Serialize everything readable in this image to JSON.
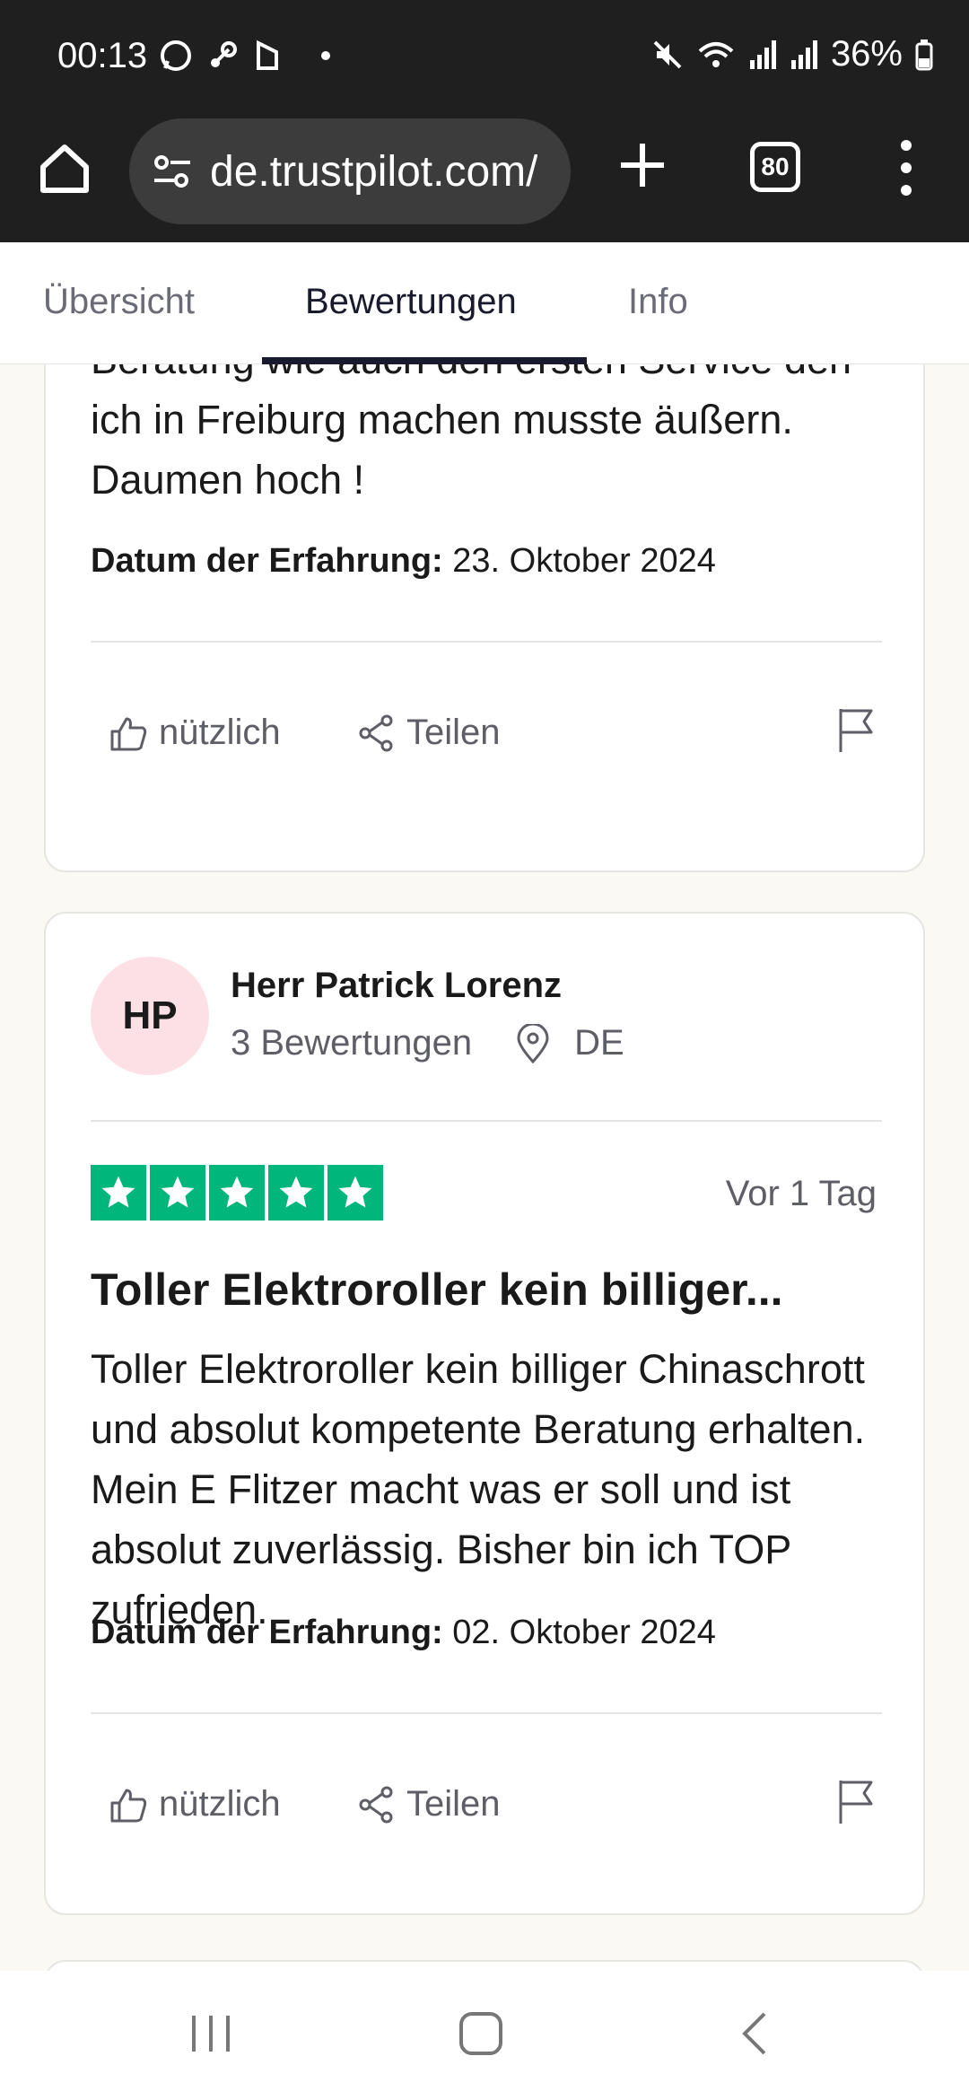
{
  "status_bar": {
    "time": "00:13",
    "battery": "36%"
  },
  "browser": {
    "url": "de.trustpilot.com/",
    "tab_count": "80"
  },
  "tabs": [
    {
      "label": "Übersicht"
    },
    {
      "label": "Bewertungen"
    },
    {
      "label": "Info"
    }
  ],
  "review1": {
    "body": "einfach nur positiv über den Kauf die Beratung wie auch den ersten Service den ich in Freiburg machen musste äußern. Daumen hoch !",
    "date_label": "Datum der Erfahrung:",
    "date_value": "23. Oktober 2024",
    "helpful_label": "nützlich",
    "share_label": "Teilen"
  },
  "review2": {
    "initials": "HP",
    "name": "Herr Patrick Lorenz",
    "reviews_count": "3 Bewertungen",
    "country": "DE",
    "rating": 5,
    "age": "Vor 1 Tag",
    "title": "Toller Elektroroller kein billiger...",
    "body": "Toller Elektroroller kein billiger Chinaschrott und absolut kompetente Beratung erhalten. Mein E Flitzer macht was er soll und ist absolut zuverlässig. Bisher bin ich TOP zufrieden.",
    "date_label": "Datum der Erfahrung:",
    "date_value": "02. Oktober 2024",
    "helpful_label": "nützlich",
    "share_label": "Teilen"
  },
  "colors": {
    "star_green": "#00b67a",
    "avatar_pink": "#fde0e6",
    "page_bg": "#faf9f4"
  }
}
